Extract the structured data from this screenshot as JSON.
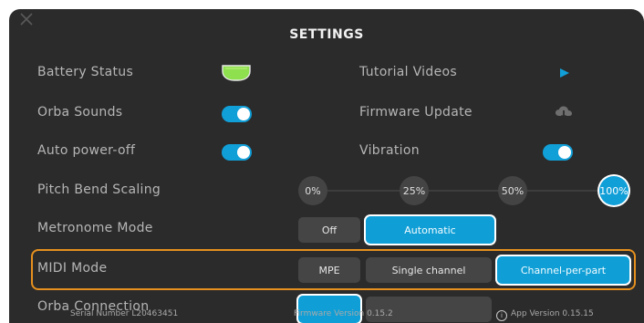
{
  "title": "SETTINGS",
  "colors": {
    "accent": "#119fd8",
    "highlight": "#e6901f",
    "battery": "#8ee04e",
    "panel": "#2b2b2b"
  },
  "left_labels": {
    "battery": "Battery Status",
    "sounds": "Orba Sounds",
    "auto_power": "Auto power-off",
    "pitch_bend": "Pitch Bend Scaling",
    "metronome": "Metronome Mode",
    "midi": "MIDI Mode",
    "connection": "Orba Connection"
  },
  "right_labels": {
    "tutorial": "Tutorial Videos",
    "firmware": "Firmware Update",
    "vibration": "Vibration"
  },
  "toggles": {
    "sounds": true,
    "auto_power": true,
    "vibration": true
  },
  "pitch_bend": {
    "options": [
      "0%",
      "25%",
      "50%",
      "100%"
    ],
    "selected": "100%"
  },
  "metronome": {
    "options": [
      "Off",
      "Automatic"
    ],
    "selected": "Automatic"
  },
  "midi": {
    "options": [
      "MPE",
      "Single channel",
      "Channel-per-part"
    ],
    "selected": "Channel-per-part"
  },
  "footer": {
    "serial": "Serial Number L20463451",
    "firmware_version": "Firmware Version 0.15.2",
    "app_version": "App Version 0.15.15"
  },
  "icons": [
    "close-icon",
    "battery-icon",
    "play-icon",
    "cloud-download-icon",
    "info-icon"
  ]
}
